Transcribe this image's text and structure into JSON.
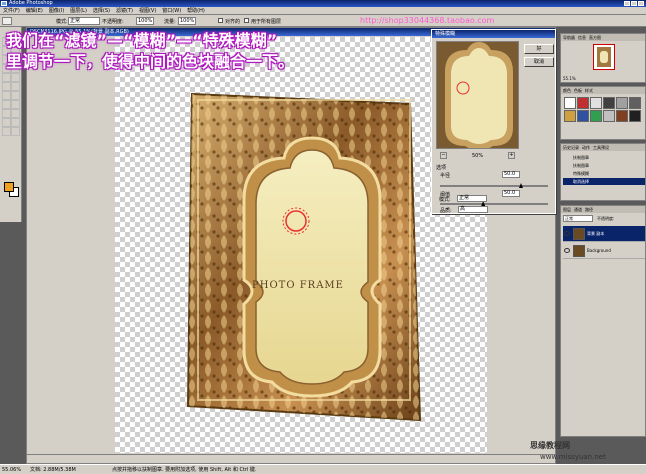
{
  "app": {
    "title": "Adobe Photoshop"
  },
  "menu": [
    "文件(F)",
    "编辑(E)",
    "图像(I)",
    "图层(L)",
    "选择(S)",
    "滤镜(T)",
    "视图(V)",
    "窗口(W)",
    "帮助(H)"
  ],
  "options": {
    "mode_label": "模式:",
    "mode_value": "正常",
    "opacity_label": "不透明度:",
    "opacity_value": "100%",
    "flow_label": "流量:",
    "flow_value": "100%",
    "aligned_label": "对齐的",
    "all_layers_label": "用于所有图层"
  },
  "watermark_top": "http://shop33044368.taobao.com",
  "document": {
    "title": "DSCN3116.JPG @ 55.1%(背景 副本,RGB)"
  },
  "tutorial": {
    "line1": "我们在“滤镜”—“模糊”—“特殊模糊”",
    "line2": "里调节一下，使得中间的色块融合一下。"
  },
  "frame_text": "PHOTO FRAME",
  "dialog": {
    "title": "特殊模糊",
    "ok": "好",
    "cancel": "取消",
    "zoom": "50%",
    "options_label": "选项",
    "radius_label": "半径",
    "radius_value": "50.0",
    "threshold_label": "阈值",
    "threshold_value": "50.0",
    "quality_label": "品质:",
    "quality_value": "高",
    "mode_label": "模式:",
    "mode_value": "正常",
    "radius_level": 0.75,
    "threshold_level": 0.4
  },
  "navigator": {
    "tabs": [
      "导航器",
      "信息",
      "直方图"
    ],
    "zoom": "55.1%"
  },
  "styles": {
    "tabs": [
      "颜色",
      "色板",
      "样式"
    ]
  },
  "history": {
    "tabs": [
      "历史记录",
      "动作",
      "工具预设"
    ],
    "items": [
      "扶制图章",
      "扶制图章",
      "特殊模糊",
      "取消选择"
    ],
    "selected_index": 3
  },
  "layers": {
    "tabs": [
      "图层",
      "通道",
      "路径"
    ],
    "mode": "正常",
    "opacity_label": "不透明度:",
    "items": [
      {
        "name": "背景 副本",
        "selected": true
      },
      {
        "name": "Background",
        "selected": false
      }
    ]
  },
  "status": {
    "zoom": "55.06%",
    "doc": "文档: 2.88M/5.38M",
    "hint": "点按并拖移以扶制图章. 要用附加选项, 使用 Shift, Alt 和 Ctrl 键."
  },
  "watermark_br": {
    "line1": "思缘教程网",
    "line2": "www.missyuan.net"
  },
  "colors": {
    "foreground": "#f0a020",
    "background": "#ffffff",
    "overlay_glow": "#c020d0",
    "watermark_pink": "#ff5ad0"
  }
}
